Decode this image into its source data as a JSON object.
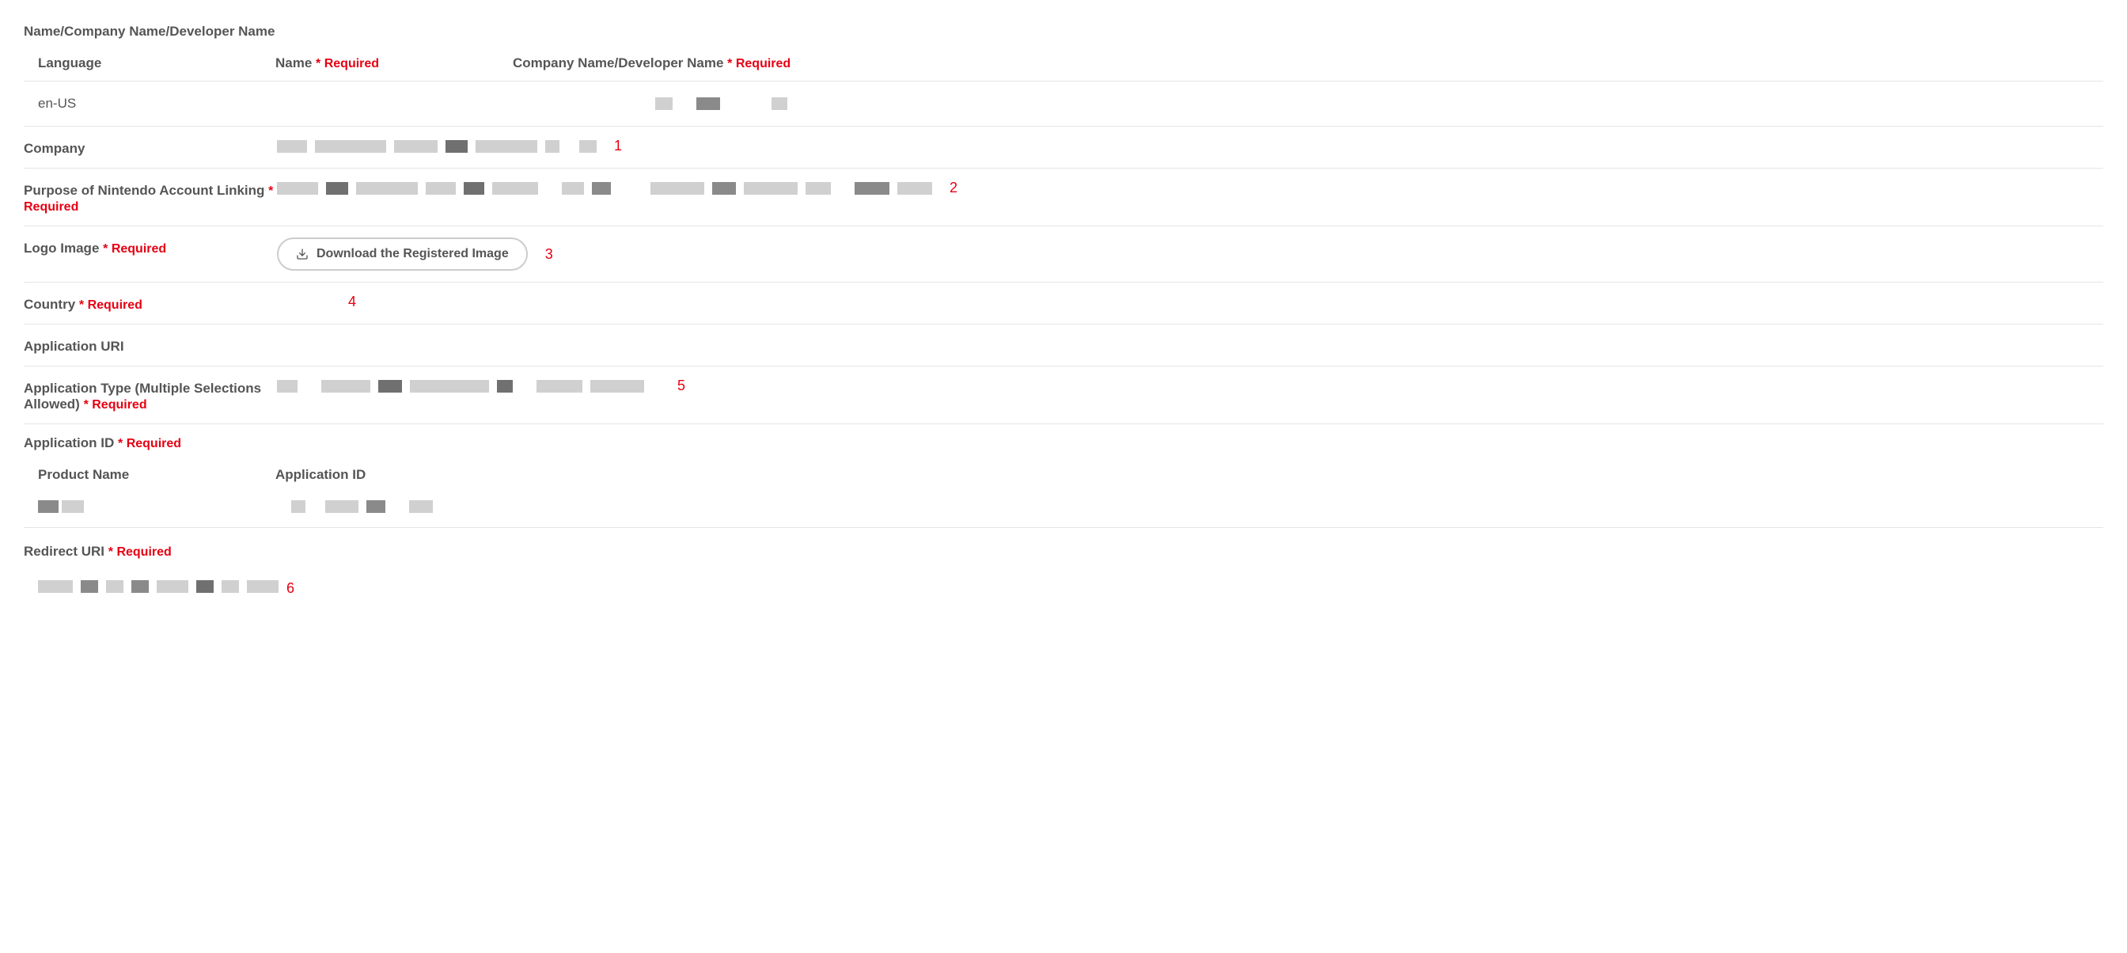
{
  "section_name_company": "Name/Company Name/Developer Name",
  "required_text": "* Required",
  "table": {
    "headers": {
      "language": "Language",
      "name": "Name",
      "company": "Company Name/Developer Name"
    },
    "row": {
      "language": "en-US"
    }
  },
  "fields": {
    "company": {
      "label": "Company",
      "annotation": "1"
    },
    "purpose": {
      "label": "Purpose of Nintendo Account Linking",
      "annotation": "2"
    },
    "logo": {
      "label": "Logo Image",
      "button": "Download the Registered Image",
      "annotation": "3"
    },
    "country": {
      "label": "Country",
      "annotation": "4"
    },
    "app_uri": {
      "label": "Application URI"
    },
    "app_type": {
      "label": "Application Type (Multiple Selections Allowed)",
      "annotation": "5"
    },
    "app_id": {
      "label": "Application ID",
      "headers": {
        "product": "Product Name",
        "id": "Application ID"
      }
    },
    "redirect": {
      "label": "Redirect URI",
      "annotation": "6"
    }
  }
}
